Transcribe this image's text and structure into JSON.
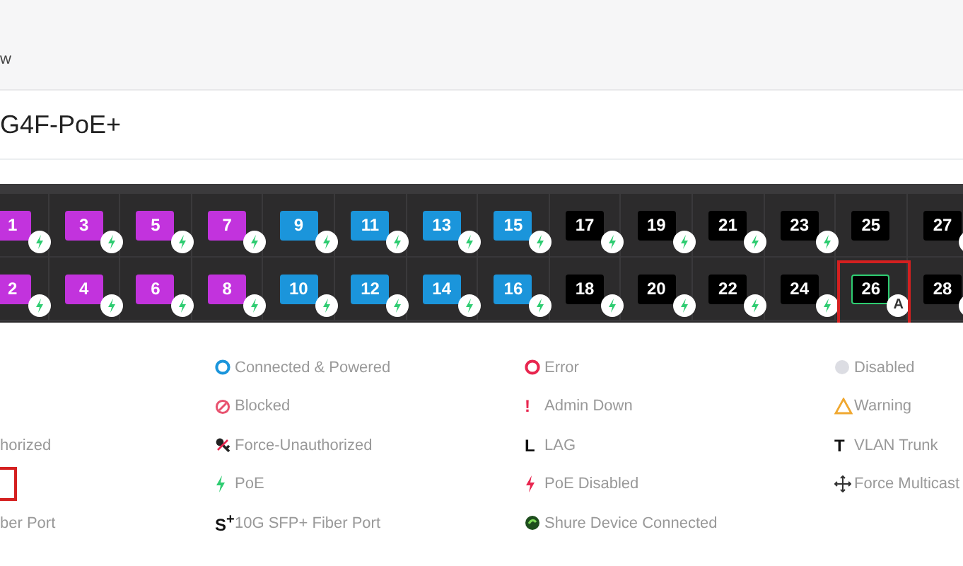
{
  "breadcrumb": "w",
  "device_title": "G4F-PoE+",
  "ports": [
    {
      "number": "1",
      "color": "#c233dd",
      "kind": "poe",
      "selected": false
    },
    {
      "number": "2",
      "color": "#c233dd",
      "kind": "poe",
      "selected": false
    },
    {
      "number": "3",
      "color": "#c233dd",
      "kind": "poe",
      "selected": false
    },
    {
      "number": "4",
      "color": "#c233dd",
      "kind": "poe",
      "selected": false
    },
    {
      "number": "5",
      "color": "#c233dd",
      "kind": "poe",
      "selected": false
    },
    {
      "number": "6",
      "color": "#c233dd",
      "kind": "poe",
      "selected": false
    },
    {
      "number": "7",
      "color": "#c233dd",
      "kind": "poe",
      "selected": false
    },
    {
      "number": "8",
      "color": "#c233dd",
      "kind": "poe",
      "selected": false
    },
    {
      "number": "9",
      "color": "#1b95db",
      "kind": "poe",
      "selected": false
    },
    {
      "number": "10",
      "color": "#1b95db",
      "kind": "poe",
      "selected": false
    },
    {
      "number": "11",
      "color": "#1b95db",
      "kind": "poe",
      "selected": false
    },
    {
      "number": "12",
      "color": "#1b95db",
      "kind": "poe",
      "selected": false
    },
    {
      "number": "13",
      "color": "#1b95db",
      "kind": "poe",
      "selected": false
    },
    {
      "number": "14",
      "color": "#1b95db",
      "kind": "poe",
      "selected": false
    },
    {
      "number": "15",
      "color": "#1b95db",
      "kind": "poe",
      "selected": false
    },
    {
      "number": "16",
      "color": "#1b95db",
      "kind": "poe",
      "selected": false
    },
    {
      "number": "17",
      "color": "#000000",
      "kind": "poe",
      "selected": false
    },
    {
      "number": "18",
      "color": "#000000",
      "kind": "poe",
      "selected": false
    },
    {
      "number": "19",
      "color": "#000000",
      "kind": "poe",
      "selected": false
    },
    {
      "number": "20",
      "color": "#000000",
      "kind": "poe",
      "selected": false
    },
    {
      "number": "21",
      "color": "#000000",
      "kind": "poe",
      "selected": false
    },
    {
      "number": "22",
      "color": "#000000",
      "kind": "poe",
      "selected": false
    },
    {
      "number": "23",
      "color": "#000000",
      "kind": "poe",
      "selected": false
    },
    {
      "number": "24",
      "color": "#000000",
      "kind": "poe",
      "selected": false
    },
    {
      "number": "25",
      "color": "#000000",
      "kind": "plain",
      "selected": false
    },
    {
      "number": "26",
      "color": "#000000",
      "kind": "letter",
      "badge_text": "A",
      "selected": true
    },
    {
      "number": "27",
      "color": "#000000",
      "kind": "cut",
      "selected": false
    },
    {
      "number": "28",
      "color": "#000000",
      "kind": "cut",
      "selected": false
    }
  ],
  "legend": [
    {
      "items": [
        {
          "kind": "ring",
          "color": "#1b95db",
          "label": "Connected & Powered"
        },
        {
          "kind": "ring",
          "color": "#e8264f",
          "label": "Error"
        },
        {
          "kind": "dot",
          "label": "Disabled"
        }
      ]
    },
    {
      "items": [
        {
          "kind": "blocked",
          "label": "Blocked"
        },
        {
          "kind": "glyph",
          "glyph": "!",
          "color": "#e8264f",
          "label": "Admin Down"
        },
        {
          "kind": "warning",
          "label": "Warning"
        }
      ]
    },
    {
      "cut_text": "horized",
      "items": [
        {
          "kind": "key",
          "label": "Force-Unauthorized"
        },
        {
          "kind": "glyph",
          "glyph": "L",
          "color": "#111111",
          "label": "LAG"
        },
        {
          "kind": "glyph",
          "glyph": "T",
          "color": "#111111",
          "label": "VLAN Trunk"
        }
      ]
    },
    {
      "cut_highlight": true,
      "items": [
        {
          "kind": "bolt",
          "color": "#2ecc71",
          "label": "PoE"
        },
        {
          "kind": "bolt",
          "color": "#e8264f",
          "label": "PoE Disabled"
        },
        {
          "kind": "move",
          "label": "Force Multicast"
        }
      ]
    },
    {
      "cut_text": "ber Port",
      "items": [
        {
          "kind": "glyph",
          "glyph": "S$^{+}$",
          "color": "#111111",
          "label": "10G SFP+ Fiber Port"
        },
        {
          "kind": "shure",
          "label": "Shure Device Connected"
        }
      ]
    }
  ]
}
